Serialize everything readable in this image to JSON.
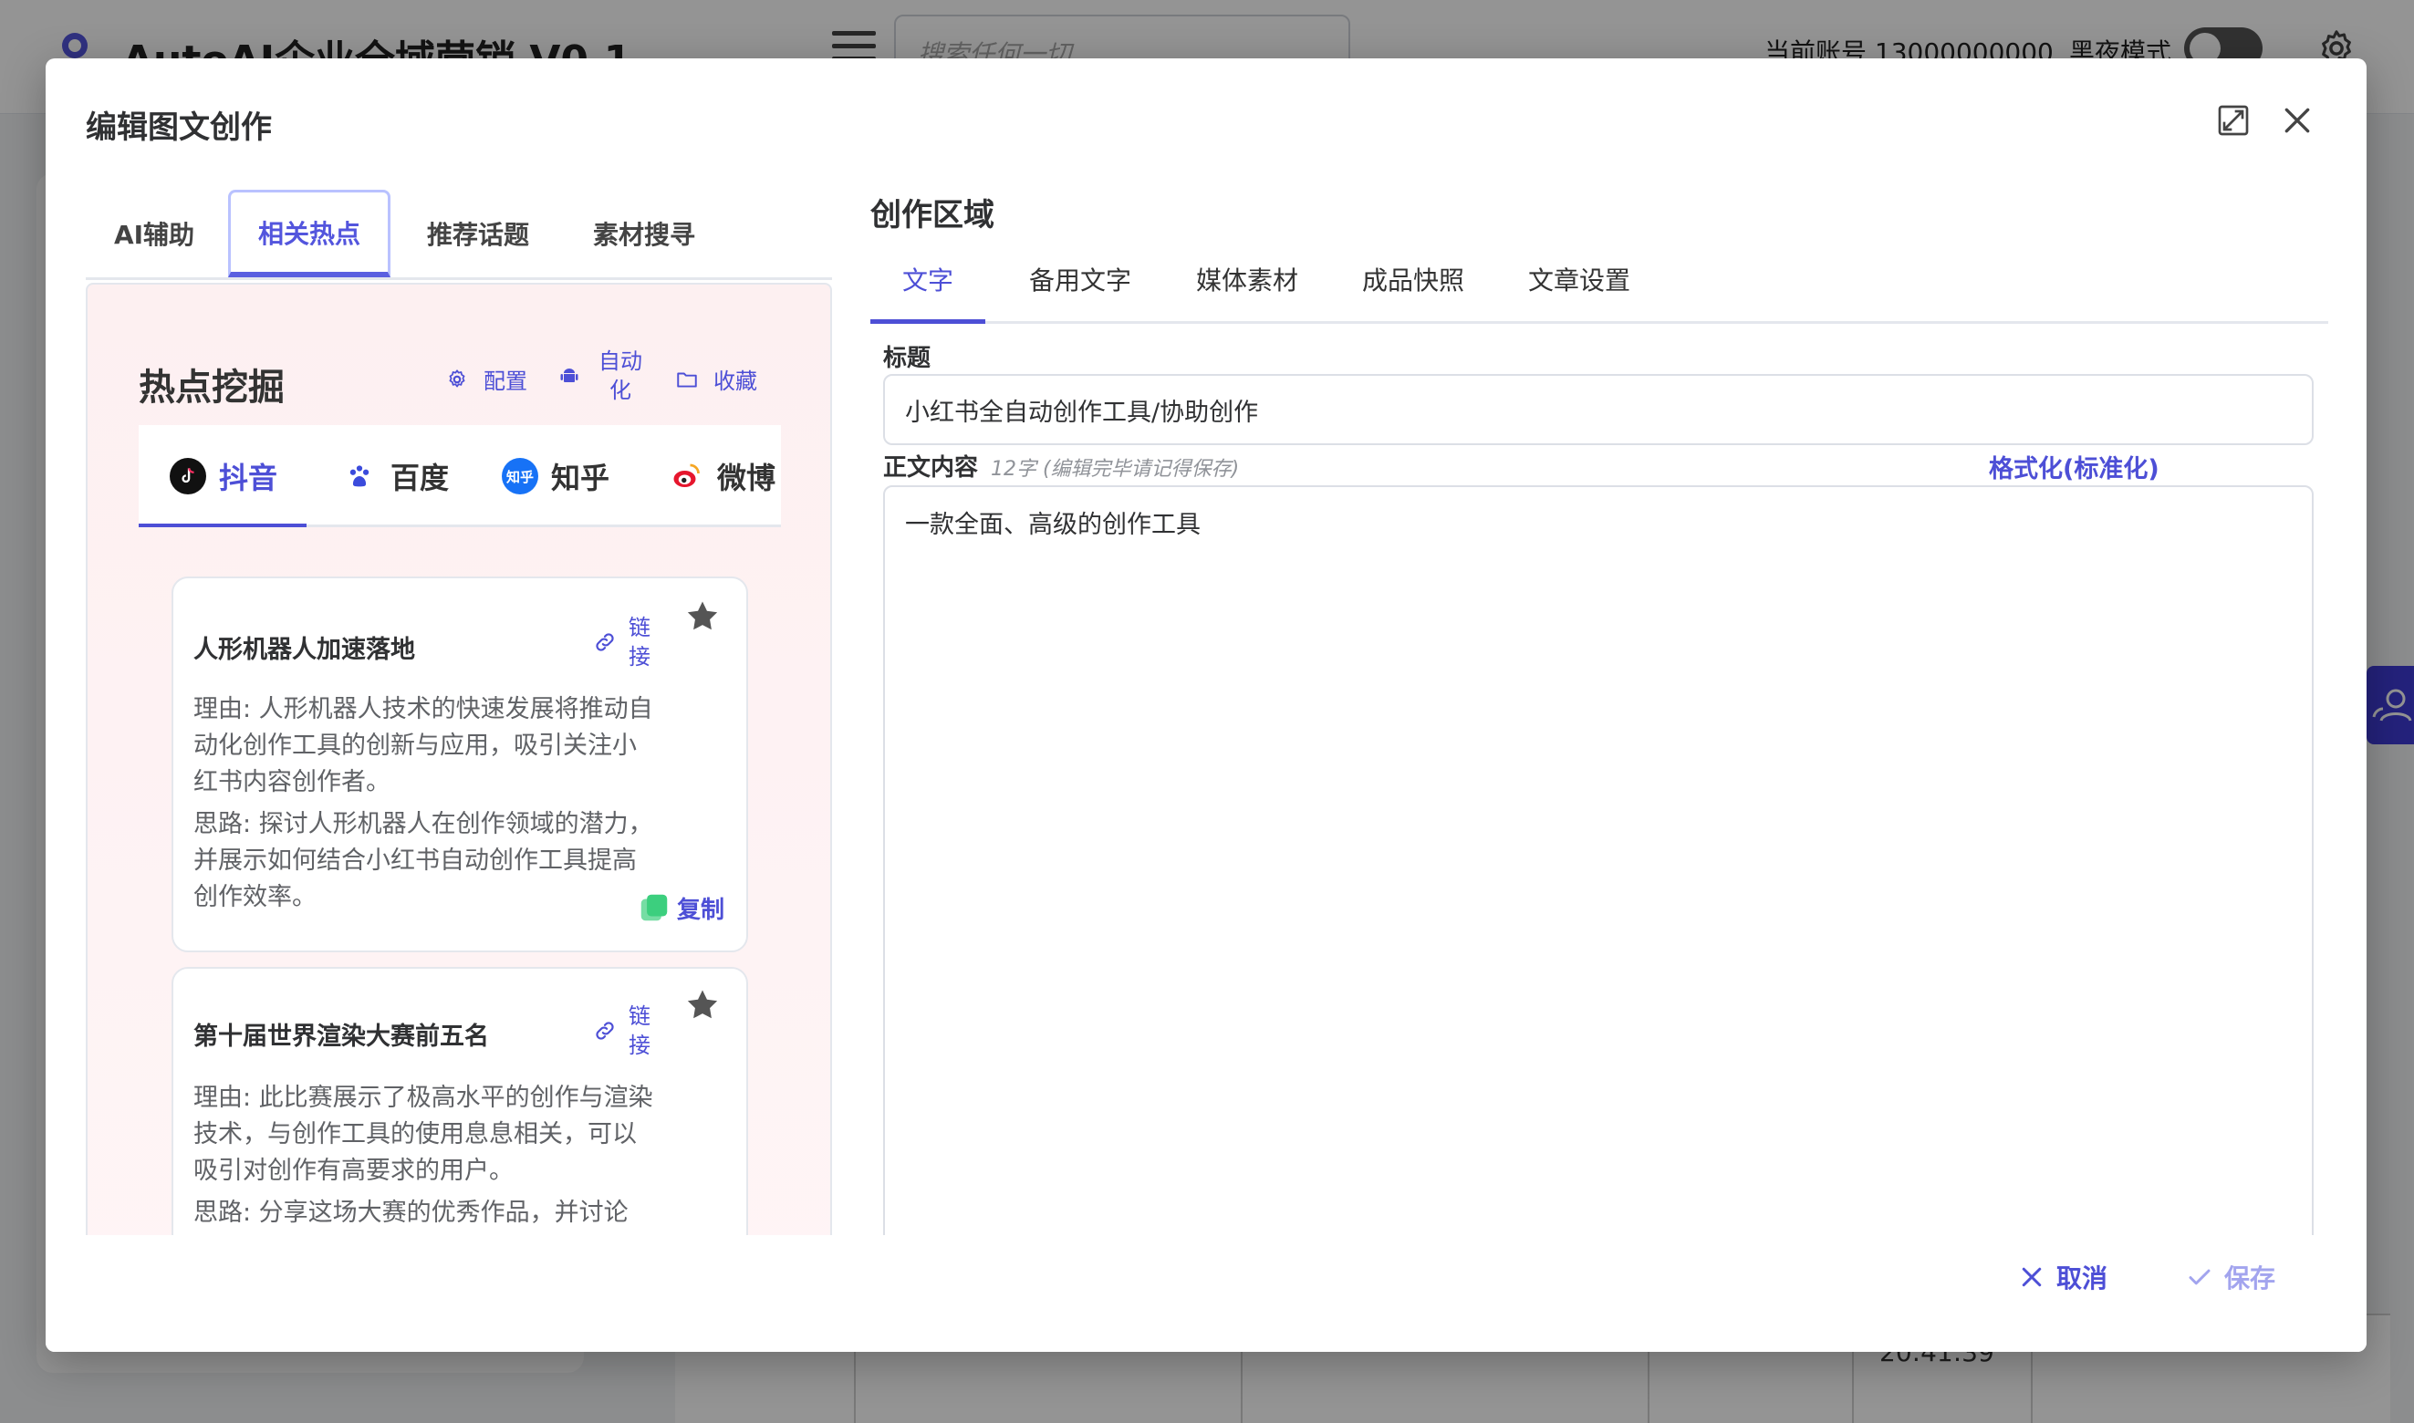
{
  "app": {
    "title": "AutoAI企业全域营销 V0.1",
    "search_placeholder": "搜索任何一切",
    "account": "当前账号 13000000000",
    "dark_mode_label": "黑夜模式",
    "table_time": "20:41:39"
  },
  "dialog": {
    "title": "编辑图文创作",
    "left_tabs": [
      "AI辅助",
      "相关热点",
      "推荐话题",
      "素材搜寻"
    ],
    "active_left_tab": "相关热点",
    "hot": {
      "title": "热点挖掘",
      "config_label": "配置",
      "auto_label": "自动化",
      "favorite_label": "收藏",
      "platforms": [
        "抖音",
        "百度",
        "知乎",
        "微博"
      ],
      "active_platform": "抖音",
      "zhihu_badge": "知乎",
      "cards": [
        {
          "title": "人形机器人加速落地",
          "link_label": "链接",
          "reason": "理由: 人形机器人技术的快速发展将推动自动化创作工具的创新与应用，吸引关注小红书内容创作者。",
          "idea": "思路: 探讨人形机器人在创作领域的潜力，并展示如何结合小红书自动创作工具提高创作效率。",
          "copy_label": "复制"
        },
        {
          "title": "第十届世界渲染大赛前五名",
          "link_label": "链接",
          "reason": "理由: 此比赛展示了极高水平的创作与渲染技术，与创作工具的使用息息相关，可以吸引对创作有高要求的用户。",
          "idea": "思路: 分享这场大赛的优秀作品，并讨论"
        }
      ]
    },
    "create": {
      "heading": "创作区域",
      "tabs": [
        "文字",
        "备用文字",
        "媒体素材",
        "成品快照",
        "文章设置"
      ],
      "active_tab": "文字",
      "title_label": "标题",
      "title_value": "小红书全自动创作工具/协助创作",
      "body_label": "正文内容",
      "body_hint": "12字 (编辑完毕请记得保存)",
      "format_label": "格式化(标准化)",
      "body_value": "一款全面、高级的创作工具"
    },
    "footer": {
      "cancel_label": "取消",
      "save_label": "保存"
    }
  },
  "colors": {
    "accent": "#4d4fd6",
    "tab_active_border": "#b9c2ff",
    "panel_bg": "#fdf0f1",
    "copy_icon": "#3ccf7e",
    "float_button": "#3f3bd6"
  },
  "icons": {
    "fullscreen": "fullscreen-icon",
    "close": "close-icon",
    "config": "gear-icon",
    "auto": "android-icon",
    "favorite": "folder-icon",
    "link": "link-icon",
    "star": "star-icon",
    "copy": "copy-icon",
    "cancel": "close-icon",
    "save": "check-icon"
  }
}
